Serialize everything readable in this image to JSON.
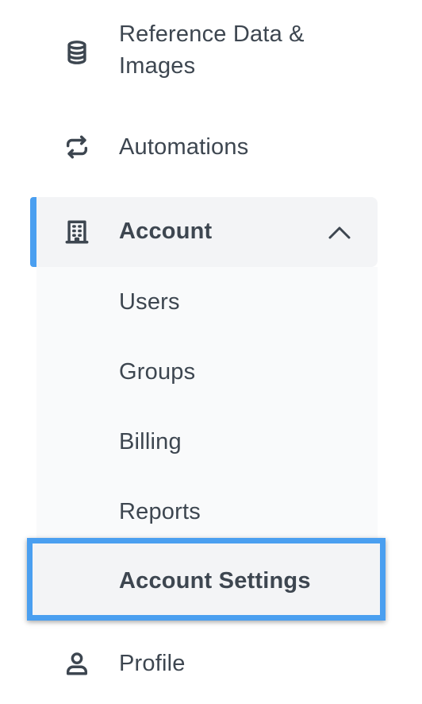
{
  "nav": {
    "reference": {
      "label": "Reference Data & Images",
      "icon": "database-icon"
    },
    "automations": {
      "label": "Automations",
      "icon": "repeat-icon"
    },
    "account": {
      "label": "Account",
      "icon": "building-icon",
      "expanded": true,
      "children": [
        {
          "label": "Users"
        },
        {
          "label": "Groups"
        },
        {
          "label": "Billing"
        },
        {
          "label": "Reports"
        },
        {
          "label": "Account Settings",
          "selected": true
        }
      ]
    },
    "profile": {
      "label": "Profile",
      "icon": "user-icon"
    }
  },
  "colors": {
    "accent": "#4a9ff0",
    "text": "#3d4650",
    "active_bg": "#f3f4f6",
    "submenu_bg": "#f9fafb"
  }
}
